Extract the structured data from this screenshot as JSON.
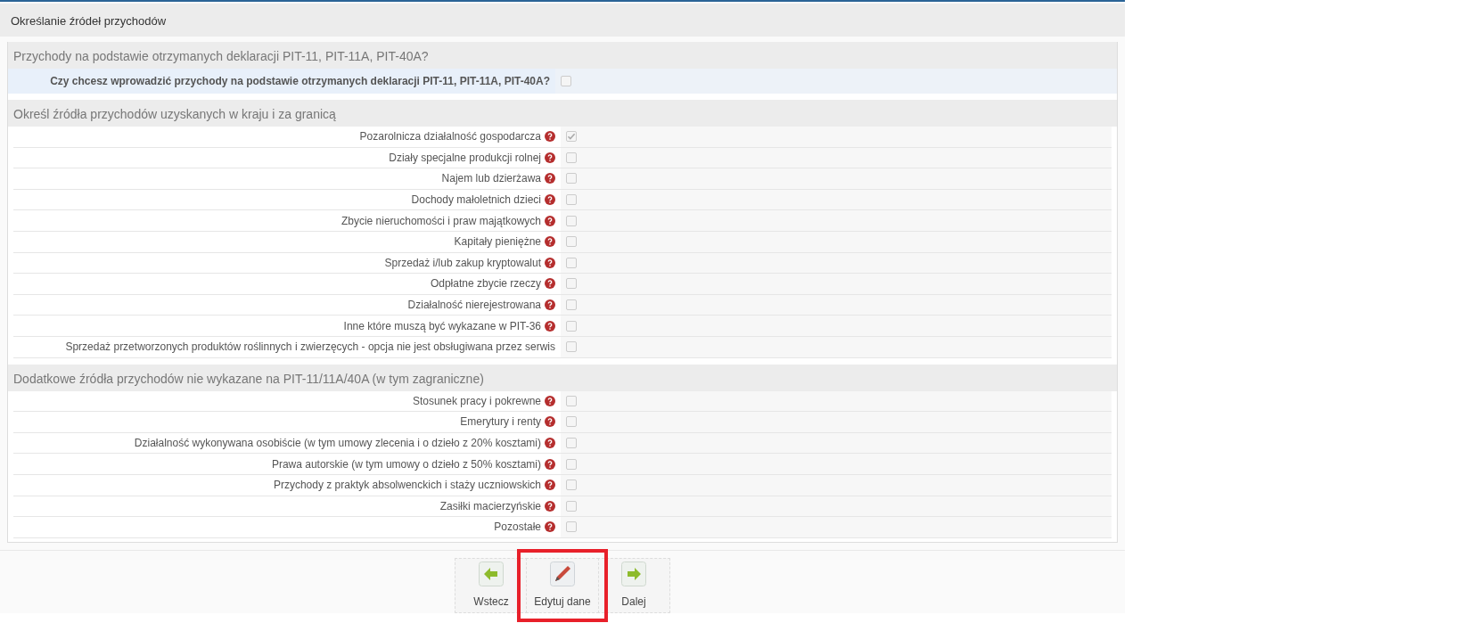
{
  "panel": {
    "title": "Określanie źródeł przychodów"
  },
  "sections": [
    {
      "title": "Przychody na podstawie otrzymanych deklaracji PIT-11, PIT-11A, PIT-40A?",
      "kind": "question",
      "items": [
        {
          "label": "Czy chcesz wprowadzić przychody na podstawie otrzymanych deklaracji PIT-11, PIT-11A, PIT-40A?",
          "help": false,
          "checked": false
        }
      ]
    },
    {
      "title": "Określ źródła przychodów uzyskanych w kraju i za granicą",
      "kind": "list",
      "items": [
        {
          "label": "Pozarolnicza działalność gospodarcza",
          "help": true,
          "checked": true
        },
        {
          "label": "Działy specjalne produkcji rolnej",
          "help": true,
          "checked": false
        },
        {
          "label": "Najem lub dzierżawa",
          "help": true,
          "checked": false
        },
        {
          "label": "Dochody małoletnich dzieci",
          "help": true,
          "checked": false
        },
        {
          "label": "Zbycie nieruchomości i praw majątkowych",
          "help": true,
          "checked": false
        },
        {
          "label": "Kapitały pieniężne",
          "help": true,
          "checked": false
        },
        {
          "label": "Sprzedaż i/lub zakup kryptowalut",
          "help": true,
          "checked": false
        },
        {
          "label": "Odpłatne zbycie rzeczy",
          "help": true,
          "checked": false
        },
        {
          "label": "Działalność nierejestrowana",
          "help": true,
          "checked": false
        },
        {
          "label": "Inne które muszą być wykazane w PIT-36",
          "help": true,
          "checked": false
        },
        {
          "label": "Sprzedaż przetworzonych produktów roślinnych i zwierzęcych - opcja nie jest obsługiwana przez serwis",
          "help": false,
          "checked": false
        }
      ]
    },
    {
      "title": "Dodatkowe źródła przychodów nie wykazane na PIT-11/11A/40A (w tym zagraniczne)",
      "kind": "list",
      "items": [
        {
          "label": "Stosunek pracy i pokrewne",
          "help": true,
          "checked": false
        },
        {
          "label": "Emerytury i renty",
          "help": true,
          "checked": false
        },
        {
          "label": "Działalność wykonywana osobiście (w tym umowy zlecenia i o dzieło z 20% kosztami)",
          "help": true,
          "checked": false
        },
        {
          "label": "Prawa autorskie (w tym umowy o dzieło z 50% kosztami)",
          "help": true,
          "checked": false
        },
        {
          "label": "Przychody z praktyk absolwenckich i staży uczniowskich",
          "help": true,
          "checked": false
        },
        {
          "label": "Zasiłki macierzyńskie",
          "help": true,
          "checked": false
        },
        {
          "label": "Pozostałe",
          "help": true,
          "checked": false
        }
      ]
    }
  ],
  "buttons": [
    {
      "label": "Wstecz",
      "kind": "back",
      "highlighted": false
    },
    {
      "label": "Edytuj dane",
      "kind": "edit",
      "highlighted": true
    },
    {
      "label": "Dalej",
      "kind": "next",
      "highlighted": false
    }
  ]
}
